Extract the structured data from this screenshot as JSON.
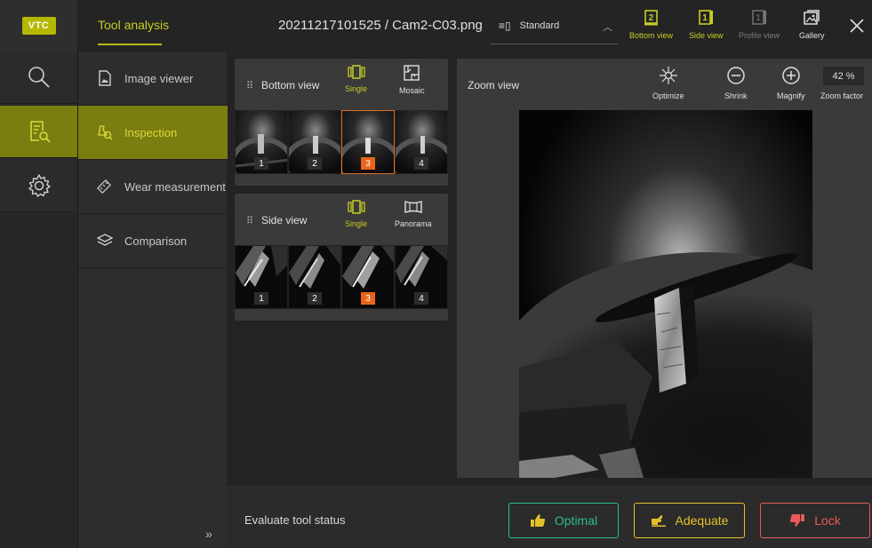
{
  "colors": {
    "accent": "#b9bc1c",
    "accent_dark": "#7a7d10",
    "selected": "#e8651a",
    "optimal": "#2bbf8a",
    "adequate": "#e5c12b",
    "lock": "#e85a5a"
  },
  "header": {
    "logo": "VTC",
    "app_title": "Tool analysis",
    "file_name": "20211217101525 / Cam2-C03.png",
    "layout_dropdown": {
      "value": "Standard"
    },
    "view_buttons": [
      {
        "label": "Bottom view",
        "badge": "2",
        "state": "active"
      },
      {
        "label": "Side view",
        "badge": "1",
        "state": "active"
      },
      {
        "label": "Profile view",
        "badge": "1",
        "state": "disabled"
      },
      {
        "label": "Gallery",
        "state": "normal"
      }
    ]
  },
  "leftnav": {
    "items": [
      {
        "icon": "search-icon",
        "active": false
      },
      {
        "icon": "inspection-icon",
        "active": true
      },
      {
        "icon": "settings-gear-icon",
        "active": false
      }
    ]
  },
  "subnav": {
    "items": [
      {
        "label": "Image viewer",
        "icon": "image-file-icon"
      },
      {
        "label": "Inspection",
        "icon": "inspection-magnifier-icon",
        "active": true
      },
      {
        "label": "Wear measurement",
        "icon": "ruler-icon"
      },
      {
        "label": "Comparison",
        "icon": "layers-icon"
      }
    ],
    "collapse": "»"
  },
  "bottom_view": {
    "title": "Bottom view",
    "modes": [
      {
        "label": "Single",
        "selected": true
      },
      {
        "label": "Mosaic",
        "selected": false
      }
    ],
    "thumbnails": [
      "1",
      "2",
      "3",
      "4"
    ],
    "selected_index": 2
  },
  "side_view": {
    "title": "Side view",
    "modes": [
      {
        "label": "Single",
        "selected": true
      },
      {
        "label": "Panorama",
        "selected": false
      }
    ],
    "thumbnails": [
      "1",
      "2",
      "3",
      "4"
    ],
    "selected_index": 2
  },
  "zoom_view": {
    "title": "Zoom view",
    "tools": [
      {
        "label": "Optimize",
        "icon": "sparkle-icon"
      },
      {
        "label": "Shrink",
        "icon": "minus-circle-icon"
      },
      {
        "label": "Magnify",
        "icon": "plus-circle-icon"
      }
    ],
    "zoom_factor_label": "Zoom factor",
    "zoom_factor_value": "42 %"
  },
  "evaluation": {
    "label": "Evaluate tool status",
    "buttons": [
      {
        "label": "Optimal",
        "icon": "thumbs-up-icon"
      },
      {
        "label": "Adequate",
        "icon": "hand-point-icon"
      },
      {
        "label": "Lock",
        "icon": "thumbs-down-icon"
      }
    ]
  }
}
